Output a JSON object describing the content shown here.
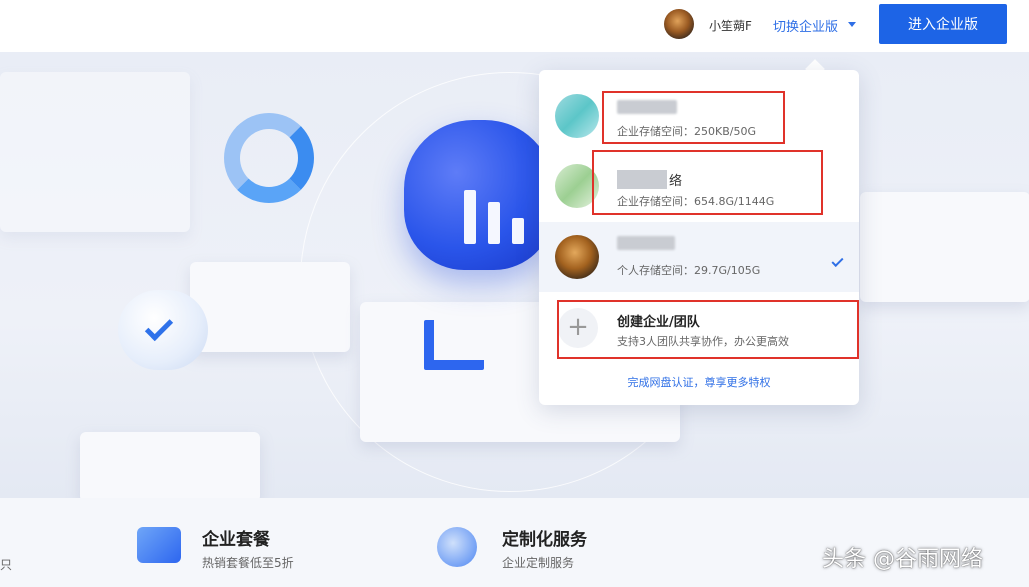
{
  "header": {
    "username": "小笙蒴F",
    "switch_label": "切换企业版",
    "enter_button": "进入企业版"
  },
  "dropdown": {
    "accounts": [
      {
        "name": "",
        "storage": "企业存储空间：250KB/50G"
      },
      {
        "name": "络",
        "storage": "企业存储空间：654.8G/1144G"
      },
      {
        "name": "",
        "storage": "个人存储空间：29.7G/105G",
        "selected": true
      }
    ],
    "create": {
      "plus": "+",
      "title": "创建企业/团队",
      "subtitle": "支持3人团队共享协作，办公更高效"
    },
    "verify_link": "完成网盘认证，尊享更多特权"
  },
  "features": [
    {
      "title": "企业套餐",
      "subtitle": "热销套餐低至5折"
    },
    {
      "title": "定制化服务",
      "subtitle": "企业定制服务"
    }
  ],
  "edge_text": "只",
  "watermark": "头条 @谷雨网络",
  "colors": {
    "accent": "#1d64e6",
    "link": "#2f6fe6",
    "annotation": "#e0322a"
  }
}
